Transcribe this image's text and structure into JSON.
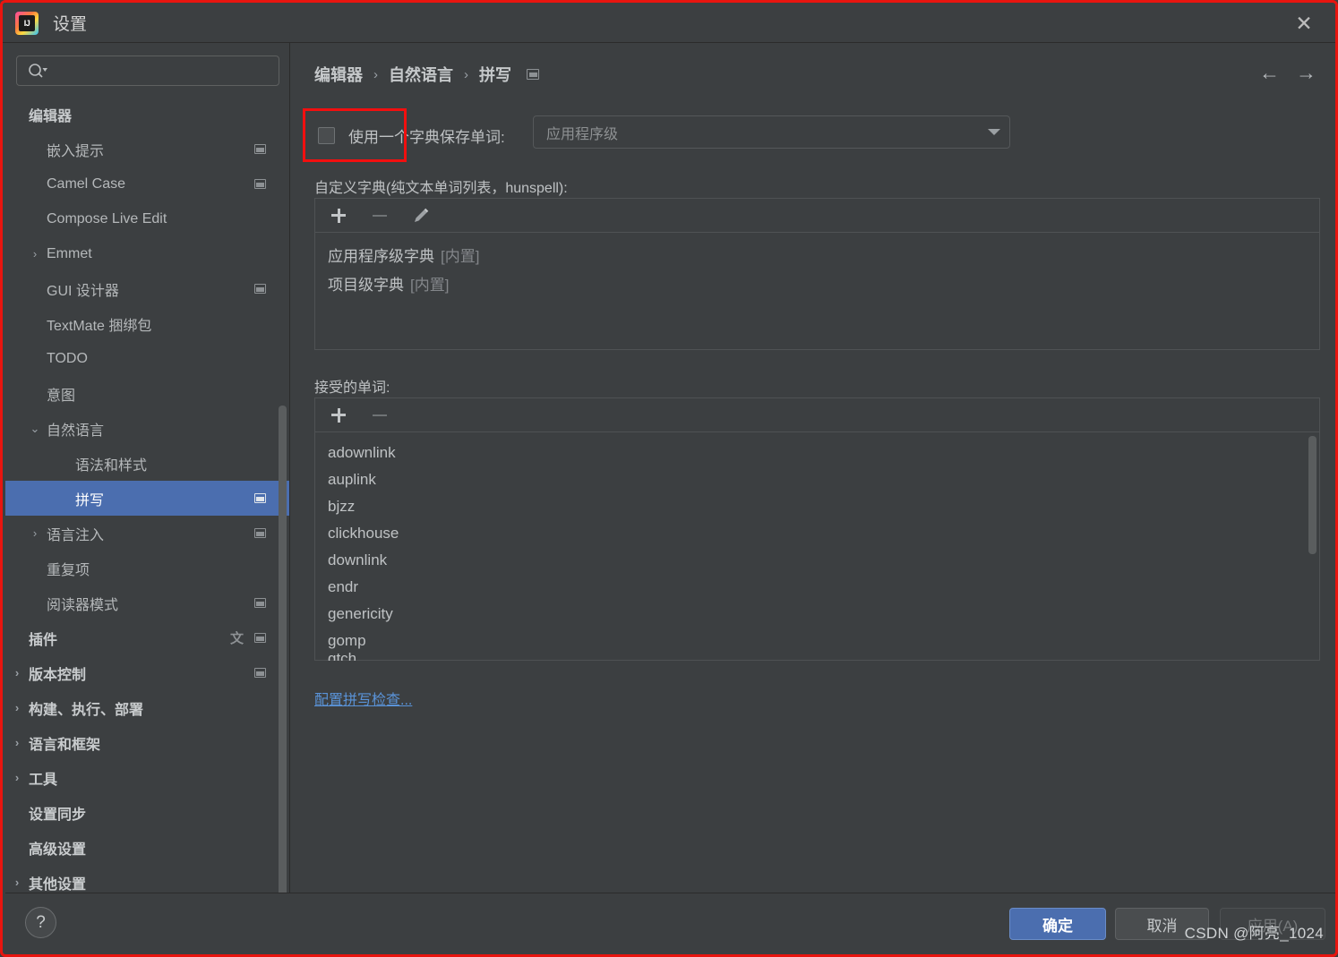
{
  "window": {
    "title": "设置",
    "logo_text": "IJ",
    "close_label": "✕"
  },
  "sidebar": {
    "search_placeholder": "",
    "search_value": "",
    "items": [
      {
        "label": "编辑器",
        "indent": 0,
        "bold": true,
        "arrow": "",
        "badge": false,
        "selected": false,
        "translate": false
      },
      {
        "label": "嵌入提示",
        "indent": 1,
        "bold": false,
        "arrow": "",
        "badge": true,
        "selected": false,
        "translate": false
      },
      {
        "label": "Camel Case",
        "indent": 1,
        "bold": false,
        "arrow": "",
        "badge": true,
        "selected": false,
        "translate": false
      },
      {
        "label": "Compose Live Edit",
        "indent": 1,
        "bold": false,
        "arrow": "",
        "badge": false,
        "selected": false,
        "translate": false
      },
      {
        "label": "Emmet",
        "indent": 1,
        "bold": false,
        "arrow": "›",
        "badge": false,
        "selected": false,
        "translate": false
      },
      {
        "label": "GUI 设计器",
        "indent": 1,
        "bold": false,
        "arrow": "",
        "badge": true,
        "selected": false,
        "translate": false
      },
      {
        "label": "TextMate 捆绑包",
        "indent": 1,
        "bold": false,
        "arrow": "",
        "badge": false,
        "selected": false,
        "translate": false
      },
      {
        "label": "TODO",
        "indent": 1,
        "bold": false,
        "arrow": "",
        "badge": false,
        "selected": false,
        "translate": false
      },
      {
        "label": "意图",
        "indent": 1,
        "bold": false,
        "arrow": "",
        "badge": false,
        "selected": false,
        "translate": false
      },
      {
        "label": "自然语言",
        "indent": 1,
        "bold": false,
        "arrow": "⌄",
        "badge": false,
        "selected": false,
        "translate": false
      },
      {
        "label": "语法和样式",
        "indent": 2,
        "bold": false,
        "arrow": "",
        "badge": false,
        "selected": false,
        "translate": false
      },
      {
        "label": "拼写",
        "indent": 2,
        "bold": false,
        "arrow": "",
        "badge": true,
        "selected": true,
        "translate": false
      },
      {
        "label": "语言注入",
        "indent": 1,
        "bold": false,
        "arrow": "›",
        "badge": true,
        "selected": false,
        "translate": false
      },
      {
        "label": "重复项",
        "indent": 1,
        "bold": false,
        "arrow": "",
        "badge": false,
        "selected": false,
        "translate": false
      },
      {
        "label": "阅读器模式",
        "indent": 1,
        "bold": false,
        "arrow": "",
        "badge": true,
        "selected": false,
        "translate": false
      },
      {
        "label": "插件",
        "indent": 0,
        "bold": true,
        "arrow": "",
        "badge": true,
        "selected": false,
        "translate": true
      },
      {
        "label": "版本控制",
        "indent": 0,
        "bold": true,
        "arrow": "›",
        "badge": true,
        "selected": false,
        "translate": false
      },
      {
        "label": "构建、执行、部署",
        "indent": 0,
        "bold": true,
        "arrow": "›",
        "badge": false,
        "selected": false,
        "translate": false
      },
      {
        "label": "语言和框架",
        "indent": 0,
        "bold": true,
        "arrow": "›",
        "badge": false,
        "selected": false,
        "translate": false
      },
      {
        "label": "工具",
        "indent": 0,
        "bold": true,
        "arrow": "›",
        "badge": false,
        "selected": false,
        "translate": false
      },
      {
        "label": "设置同步",
        "indent": 0,
        "bold": true,
        "arrow": "",
        "badge": false,
        "selected": false,
        "translate": false
      },
      {
        "label": "高级设置",
        "indent": 0,
        "bold": true,
        "arrow": "",
        "badge": false,
        "selected": false,
        "translate": false
      },
      {
        "label": "其他设置",
        "indent": 0,
        "bold": true,
        "arrow": "›",
        "badge": false,
        "selected": false,
        "translate": false
      }
    ]
  },
  "main": {
    "breadcrumb": [
      "编辑器",
      "自然语言",
      "拼写"
    ],
    "breadcrumb_sep": "›",
    "nav_back": "←",
    "nav_forward": "→",
    "save_words_checkbox_label": "使用一个字典保存单词:",
    "save_words_checked": false,
    "scope_combo_value": "应用程序级",
    "custom_dict_label": "自定义字典(纯文本单词列表，hunspell):",
    "custom_dict_items": [
      {
        "name": "应用程序级字典",
        "tag": "[内置]"
      },
      {
        "name": "项目级字典",
        "tag": "[内置]"
      }
    ],
    "accepted_words_label": "接受的单词:",
    "accepted_words": [
      "adownlink",
      "auplink",
      "bjzz",
      "clickhouse",
      "downlink",
      "endr",
      "genericity",
      "gomp"
    ],
    "accepted_words_clipped": "gtch",
    "configure_link": "配置拼写检查..."
  },
  "footer": {
    "help_label": "?",
    "ok_label": "确定",
    "cancel_label": "取消",
    "apply_label": "应用(A)"
  },
  "watermark": "CSDN @阿亮_1024",
  "colors": {
    "accent": "#4b6eaf",
    "highlight_border": "#f20f0f",
    "link": "#5a93d8",
    "background": "#3c3f41"
  }
}
